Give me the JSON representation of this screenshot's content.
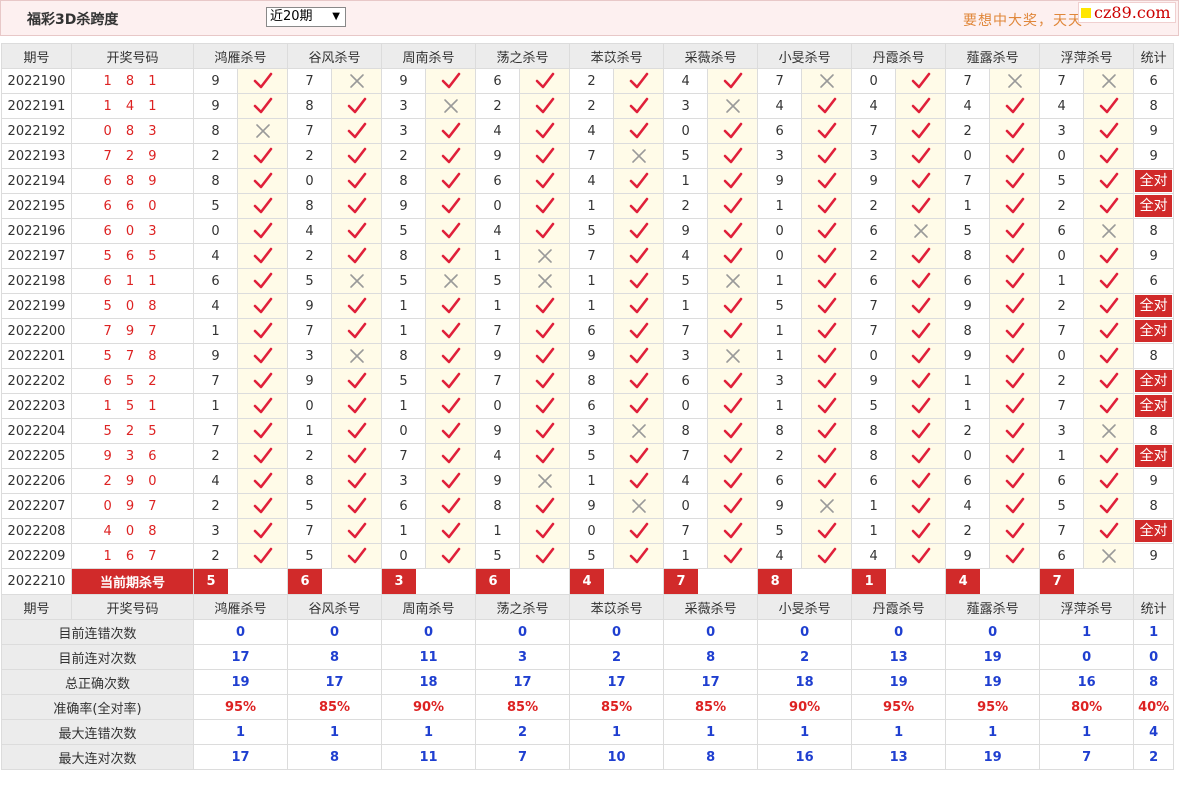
{
  "header": {
    "title": "福彩3D杀跨度",
    "range_select": "近20期",
    "slogan": "要想中大奖，天天",
    "logo_text": "cz89.com"
  },
  "columns": {
    "period": "期号",
    "draw": "开奖号码",
    "experts": [
      "鸿雁杀号",
      "谷风杀号",
      "周南杀号",
      "荡之杀号",
      "苯苡杀号",
      "采薇杀号",
      "小旻杀号",
      "丹霞杀号",
      "薤露杀号",
      "浮萍杀号"
    ],
    "stat": "统计"
  },
  "rows": [
    {
      "period": "2022190",
      "draw": "1 8 1",
      "kills": [
        9,
        7,
        9,
        6,
        2,
        4,
        7,
        0,
        7,
        7
      ],
      "hits": [
        1,
        0,
        1,
        1,
        1,
        1,
        0,
        1,
        0,
        0
      ],
      "stat": "6"
    },
    {
      "period": "2022191",
      "draw": "1 4 1",
      "kills": [
        9,
        8,
        3,
        2,
        2,
        3,
        4,
        4,
        4,
        4
      ],
      "hits": [
        1,
        1,
        0,
        1,
        1,
        0,
        1,
        1,
        1,
        1
      ],
      "stat": "8"
    },
    {
      "period": "2022192",
      "draw": "0 8 3",
      "kills": [
        8,
        7,
        3,
        4,
        4,
        0,
        6,
        7,
        2,
        3
      ],
      "hits": [
        0,
        1,
        1,
        1,
        1,
        1,
        1,
        1,
        1,
        1
      ],
      "stat": "9"
    },
    {
      "period": "2022193",
      "draw": "7 2 9",
      "kills": [
        2,
        2,
        2,
        9,
        7,
        5,
        3,
        3,
        0,
        0
      ],
      "hits": [
        1,
        1,
        1,
        1,
        0,
        1,
        1,
        1,
        1,
        1
      ],
      "stat": "9"
    },
    {
      "period": "2022194",
      "draw": "6 8 9",
      "kills": [
        8,
        0,
        8,
        6,
        4,
        1,
        9,
        9,
        7,
        5
      ],
      "hits": [
        1,
        1,
        1,
        1,
        1,
        1,
        1,
        1,
        1,
        1
      ],
      "stat": "全对"
    },
    {
      "period": "2022195",
      "draw": "6 6 0",
      "kills": [
        5,
        8,
        9,
        0,
        1,
        2,
        1,
        2,
        1,
        2
      ],
      "hits": [
        1,
        1,
        1,
        1,
        1,
        1,
        1,
        1,
        1,
        1
      ],
      "stat": "全对"
    },
    {
      "period": "2022196",
      "draw": "6 0 3",
      "kills": [
        0,
        4,
        5,
        4,
        5,
        9,
        0,
        6,
        5,
        6
      ],
      "hits": [
        1,
        1,
        1,
        1,
        1,
        1,
        1,
        0,
        1,
        0
      ],
      "stat": "8"
    },
    {
      "period": "2022197",
      "draw": "5 6 5",
      "kills": [
        4,
        2,
        8,
        1,
        7,
        4,
        0,
        2,
        8,
        0
      ],
      "hits": [
        1,
        1,
        1,
        0,
        1,
        1,
        1,
        1,
        1,
        1
      ],
      "stat": "9"
    },
    {
      "period": "2022198",
      "draw": "6 1 1",
      "kills": [
        6,
        5,
        5,
        5,
        1,
        5,
        1,
        6,
        6,
        1
      ],
      "hits": [
        1,
        0,
        0,
        0,
        1,
        0,
        1,
        1,
        1,
        1
      ],
      "stat": "6"
    },
    {
      "period": "2022199",
      "draw": "5 0 8",
      "kills": [
        4,
        9,
        1,
        1,
        1,
        1,
        5,
        7,
        9,
        2
      ],
      "hits": [
        1,
        1,
        1,
        1,
        1,
        1,
        1,
        1,
        1,
        1
      ],
      "stat": "全对"
    },
    {
      "period": "2022200",
      "draw": "7 9 7",
      "kills": [
        1,
        7,
        1,
        7,
        6,
        7,
        1,
        7,
        8,
        7
      ],
      "hits": [
        1,
        1,
        1,
        1,
        1,
        1,
        1,
        1,
        1,
        1
      ],
      "stat": "全对"
    },
    {
      "period": "2022201",
      "draw": "5 7 8",
      "kills": [
        9,
        3,
        8,
        9,
        9,
        3,
        1,
        0,
        9,
        0
      ],
      "hits": [
        1,
        0,
        1,
        1,
        1,
        0,
        1,
        1,
        1,
        1
      ],
      "stat": "8"
    },
    {
      "period": "2022202",
      "draw": "6 5 2",
      "kills": [
        7,
        9,
        5,
        7,
        8,
        6,
        3,
        9,
        1,
        2
      ],
      "hits": [
        1,
        1,
        1,
        1,
        1,
        1,
        1,
        1,
        1,
        1
      ],
      "stat": "全对"
    },
    {
      "period": "2022203",
      "draw": "1 5 1",
      "kills": [
        1,
        0,
        1,
        0,
        6,
        0,
        1,
        5,
        1,
        7
      ],
      "hits": [
        1,
        1,
        1,
        1,
        1,
        1,
        1,
        1,
        1,
        1
      ],
      "stat": "全对"
    },
    {
      "period": "2022204",
      "draw": "5 2 5",
      "kills": [
        7,
        1,
        0,
        9,
        3,
        8,
        8,
        8,
        2,
        3
      ],
      "hits": [
        1,
        1,
        1,
        1,
        0,
        1,
        1,
        1,
        1,
        0
      ],
      "stat": "8"
    },
    {
      "period": "2022205",
      "draw": "9 3 6",
      "kills": [
        2,
        2,
        7,
        4,
        5,
        7,
        2,
        8,
        0,
        1
      ],
      "hits": [
        1,
        1,
        1,
        1,
        1,
        1,
        1,
        1,
        1,
        1
      ],
      "stat": "全对"
    },
    {
      "period": "2022206",
      "draw": "2 9 0",
      "kills": [
        4,
        8,
        3,
        9,
        1,
        4,
        6,
        6,
        6,
        6
      ],
      "hits": [
        1,
        1,
        1,
        0,
        1,
        1,
        1,
        1,
        1,
        1
      ],
      "stat": "9"
    },
    {
      "period": "2022207",
      "draw": "0 9 7",
      "kills": [
        2,
        5,
        6,
        8,
        9,
        0,
        9,
        1,
        4,
        5
      ],
      "hits": [
        1,
        1,
        1,
        1,
        0,
        1,
        0,
        1,
        1,
        1
      ],
      "stat": "8"
    },
    {
      "period": "2022208",
      "draw": "4 0 8",
      "kills": [
        3,
        7,
        1,
        1,
        0,
        7,
        5,
        1,
        2,
        7
      ],
      "hits": [
        1,
        1,
        1,
        1,
        1,
        1,
        1,
        1,
        1,
        1
      ],
      "stat": "全对"
    },
    {
      "period": "2022209",
      "draw": "1 6 7",
      "kills": [
        2,
        5,
        0,
        5,
        5,
        1,
        4,
        4,
        9,
        6
      ],
      "hits": [
        1,
        1,
        1,
        1,
        1,
        1,
        1,
        1,
        1,
        0
      ],
      "stat": "9"
    }
  ],
  "current": {
    "period": "2022210",
    "label": "当前期杀号",
    "kills": [
      "5",
      "6",
      "3",
      "6",
      "4",
      "7",
      "8",
      "1",
      "4",
      "7"
    ]
  },
  "summary": [
    {
      "label": "目前连错次数",
      "values": [
        "0",
        "0",
        "0",
        "0",
        "0",
        "0",
        "0",
        "0",
        "0",
        "1"
      ],
      "stat": "1"
    },
    {
      "label": "目前连对次数",
      "values": [
        "17",
        "8",
        "11",
        "3",
        "2",
        "8",
        "2",
        "13",
        "19",
        "0"
      ],
      "stat": "0"
    },
    {
      "label": "总正确次数",
      "values": [
        "19",
        "17",
        "18",
        "17",
        "17",
        "17",
        "18",
        "19",
        "19",
        "16"
      ],
      "stat": "8"
    },
    {
      "label": "准确率(全对率)",
      "values": [
        "95%",
        "85%",
        "90%",
        "85%",
        "85%",
        "85%",
        "90%",
        "95%",
        "95%",
        "80%"
      ],
      "stat": "40%"
    },
    {
      "label": "最大连错次数",
      "values": [
        "1",
        "1",
        "1",
        "2",
        "1",
        "1",
        "1",
        "1",
        "1",
        "1"
      ],
      "stat": "4"
    },
    {
      "label": "最大连对次数",
      "values": [
        "17",
        "8",
        "11",
        "7",
        "10",
        "8",
        "16",
        "13",
        "19",
        "7"
      ],
      "stat": "2"
    }
  ],
  "colors": {
    "accent_red": "#d12a2a",
    "stat_blue": "#1f3fd0",
    "tick_red": "#e0203a",
    "cross_gray": "#9a9a9a"
  },
  "icons": {
    "hit": "check-mark-icon",
    "miss": "cross-mark-icon"
  }
}
